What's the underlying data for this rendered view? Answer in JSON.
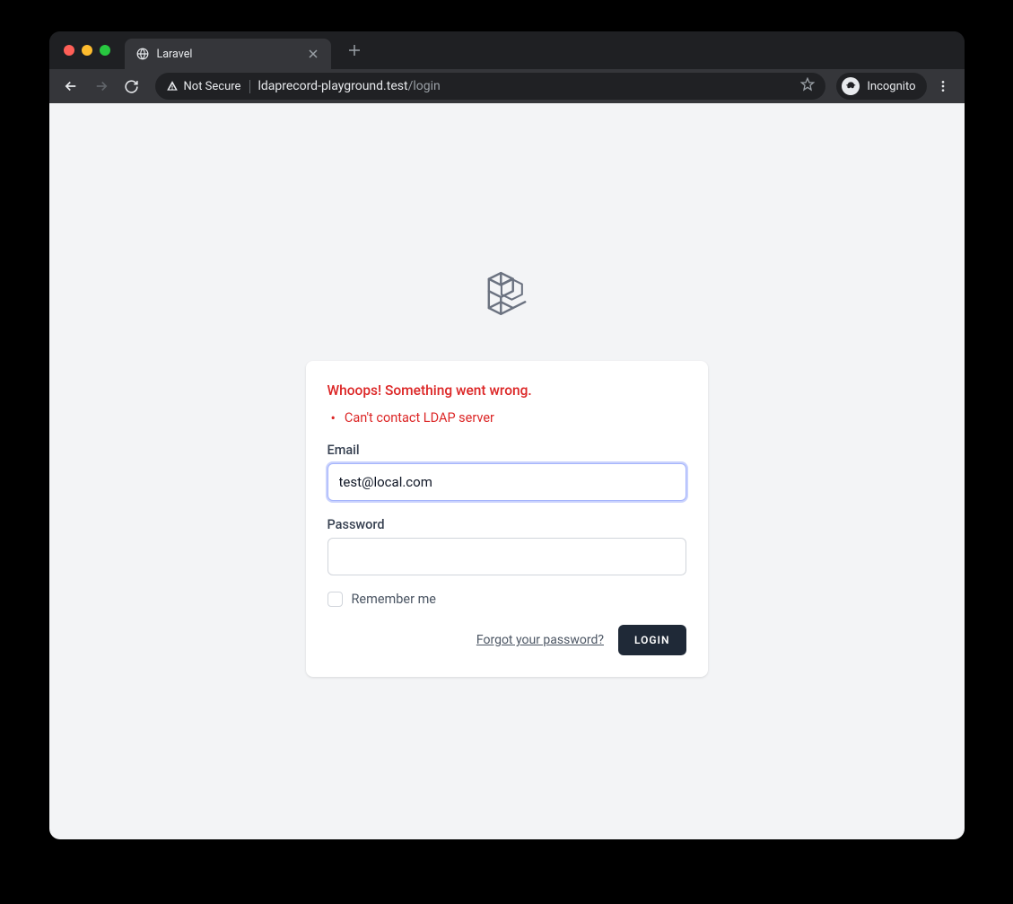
{
  "browser": {
    "tab_title": "Laravel",
    "security_label": "Not Secure",
    "url_host": "ldaprecord-playground.test",
    "url_path": "/login",
    "incognito_label": "Incognito"
  },
  "form": {
    "error_title": "Whoops! Something went wrong.",
    "error_messages": [
      "Can't contact LDAP server"
    ],
    "email_label": "Email",
    "email_value": "test@local.com",
    "password_label": "Password",
    "password_value": "",
    "remember_label": "Remember me",
    "forgot_link": "Forgot your password?",
    "login_button": "LOGIN"
  }
}
